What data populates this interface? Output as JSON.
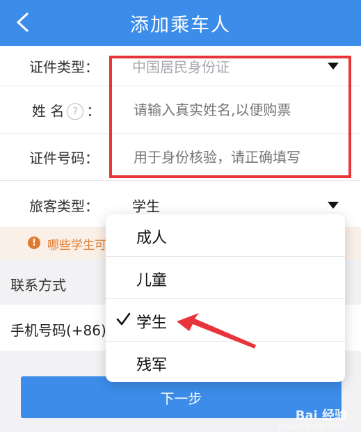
{
  "header": {
    "title": "添加乘车人"
  },
  "form": {
    "id_type": {
      "label": "证件类型：",
      "value": "中国居民身份证"
    },
    "name": {
      "label_left": "姓",
      "label_right": "名",
      "help": "?",
      "colon": "：",
      "placeholder": "请输入真实姓名,以便购票"
    },
    "id_number": {
      "label": "证件号码：",
      "placeholder": "用于身份核验，请正确填写"
    },
    "passenger_type": {
      "label": "旅客类型：",
      "value": "学生"
    }
  },
  "notice": {
    "icon": "!",
    "text": "哪些学生可"
  },
  "contact": {
    "section_title": "联系方式",
    "phone_label": "手机号码(+86)"
  },
  "next_button": {
    "label": "下一步"
  },
  "dropdown": {
    "options": [
      "成人",
      "儿童",
      "学生",
      "残军"
    ],
    "selected": "学生"
  },
  "watermark": {
    "text": "Bai 经验",
    "sub": "jingyan.baidu.com"
  },
  "colors": {
    "primary": "#3c8ce9",
    "highlight": "#e8353b",
    "notice": "#e07c2f"
  }
}
